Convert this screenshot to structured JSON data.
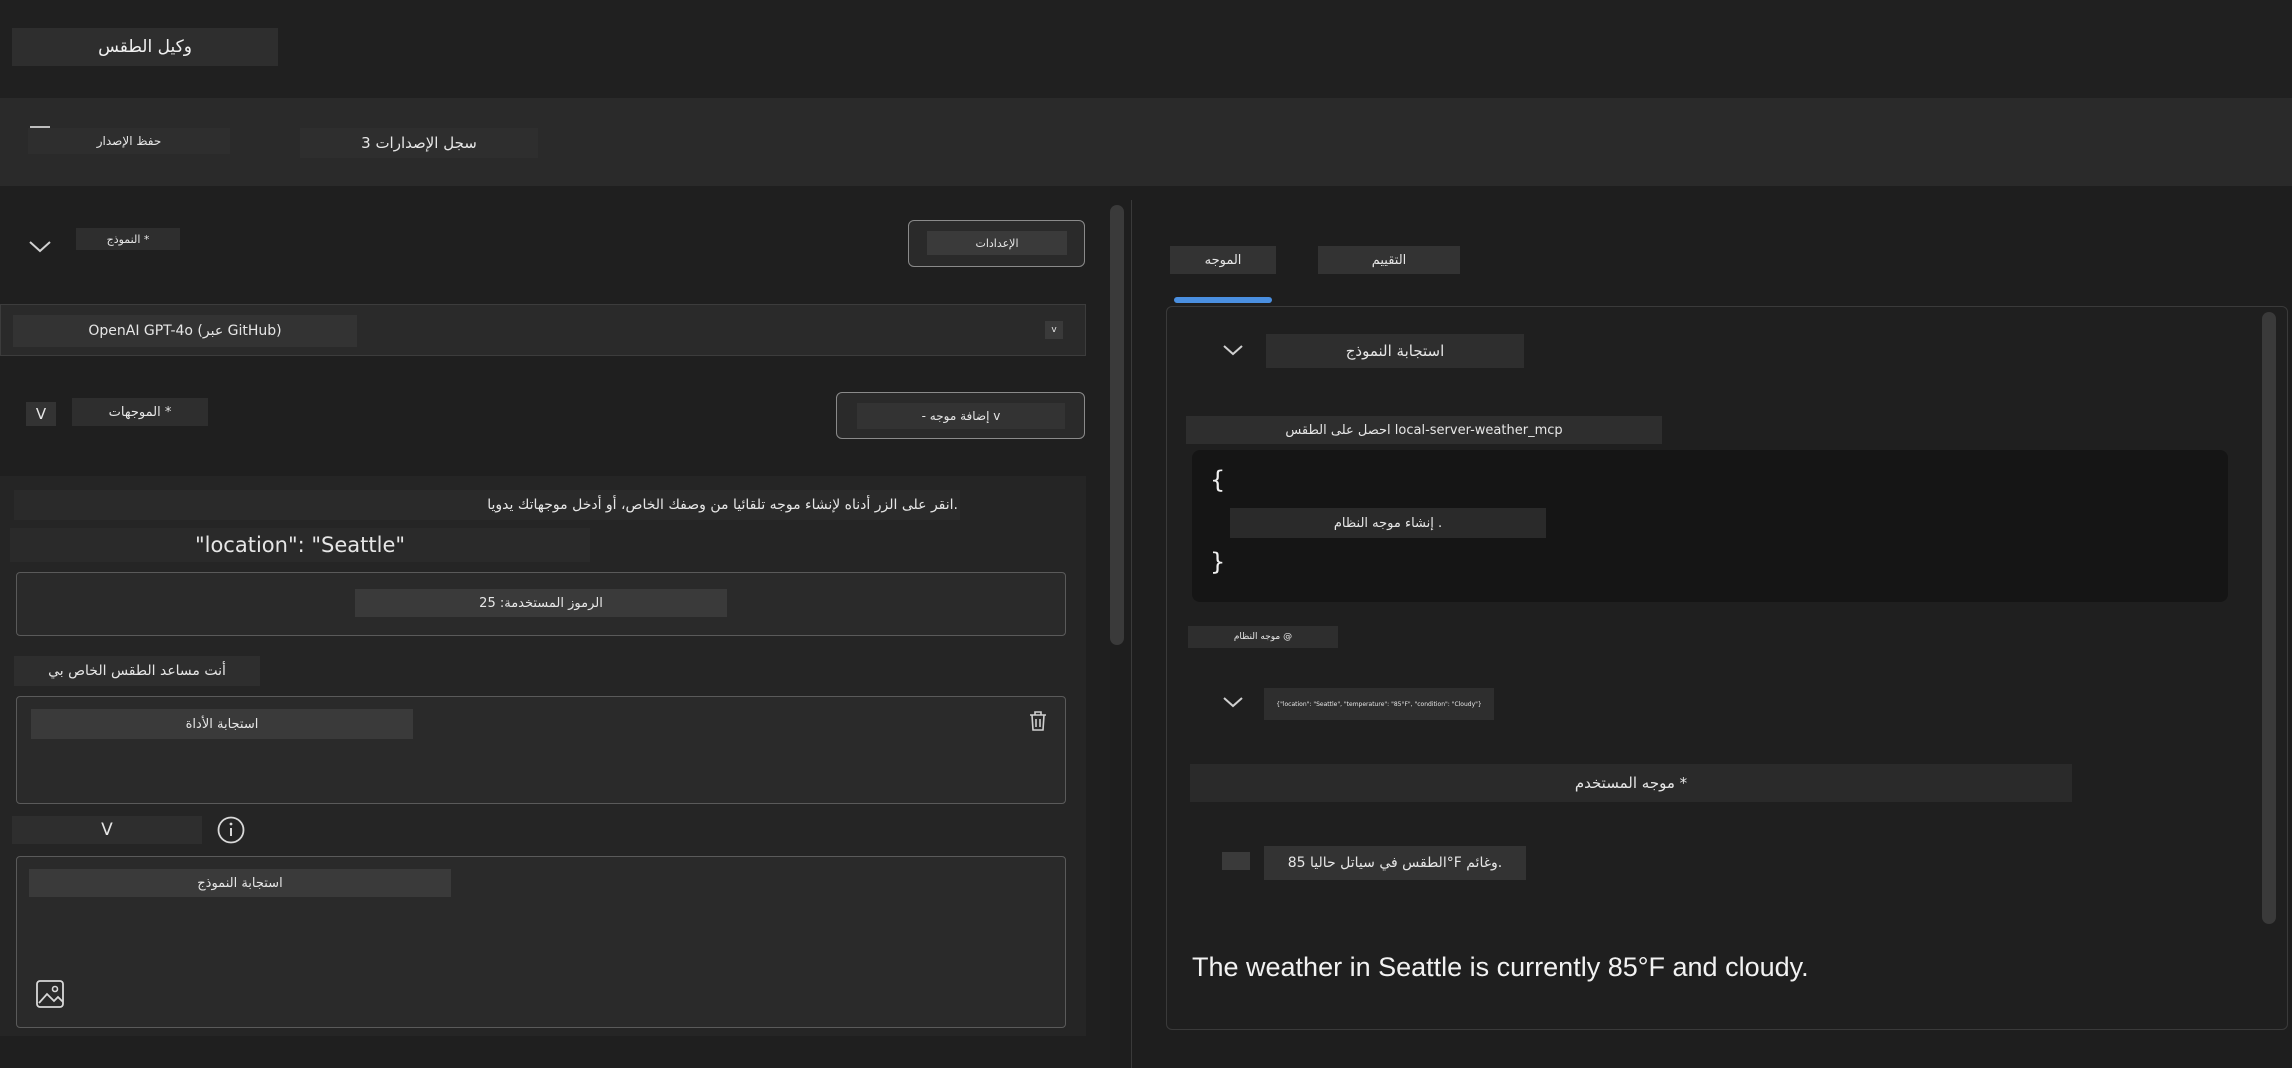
{
  "app": {
    "title": "وكيل الطقس"
  },
  "toolbar": {
    "save_version": "حفظ الإصدار",
    "version_history": "3 سجل الإصدارات"
  },
  "left": {
    "model_label": "النموذج *",
    "settings_label": "الإعدادات",
    "model_value": "OpenAI GPT-4o (عبر GitHub)",
    "model_chevron": "v",
    "prompts_label": "الموجهات *",
    "prompts_toggle": "V",
    "add_prompt": "- إضافة موجه v",
    "instructions": "انقر على الزر أدناه لإنشاء موجه تلقائيا من وصفك الخاص، أو أدخل موجهاتك يدويا.",
    "location_line": "\"location\": \"Seattle\"",
    "tokens_used": "الرموز المستخدمة: 25",
    "system_text": "أنت مساعد الطقس الخاص بي",
    "tool_response": "استجابة الأداة",
    "toggle_v": "V",
    "model_response": "استجابة النموذج"
  },
  "right": {
    "tabs": [
      {
        "label": "الموجه",
        "active": true
      },
      {
        "label": "التقييم",
        "active": false
      }
    ],
    "model_response_header": "استجابة النموذج",
    "tool_call": "احصل على الطقس local-server-weather_mcp",
    "code_open": "{",
    "code_inner": "إنشاء موجه النظام .",
    "code_close": "}",
    "system_prompt_tag": "موجه النظام @",
    "tool_json": "{\"location\": \"Seattle\", \"temperature\": \"85°F\", \"condition\": \"Cloudy\"}",
    "user_prompt": "موجه المستخدم *",
    "assistant_ar": "الطقس في سياتل حاليا 85°F وغائم.",
    "assistant_en": "The weather in Seattle is currently 85°F and cloudy."
  },
  "colors": {
    "accent": "#4a8fe0",
    "background": "#1e1e1e"
  },
  "icons": [
    "chevron-down-icon",
    "trash-icon",
    "info-icon",
    "image-icon"
  ]
}
